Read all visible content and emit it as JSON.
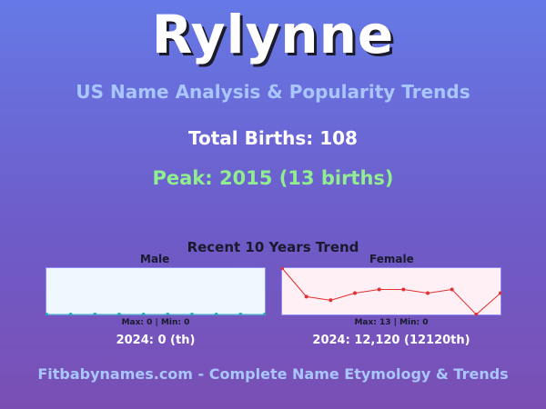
{
  "title": "Rylynne",
  "subtitle": "US Name Analysis & Popularity Trends",
  "total_births": "Total Births: 108",
  "peak": "Peak: 2015 (13 births)",
  "footer": "Fitbabynames.com - Complete Name Etymology & Trends",
  "colors": {
    "male_line": "#2aa7b8",
    "male_bg": "#f0f8ff",
    "female_line": "#e03030",
    "female_bg": "#fff0f5",
    "panel_border": "#8c8cff"
  },
  "chart_data": [
    {
      "type": "line",
      "title": "Recent 10 Years Trend",
      "panel_label": "Male",
      "series": [
        {
          "values": [
            0,
            0,
            0,
            0,
            0,
            0,
            0,
            0,
            0,
            0
          ]
        }
      ],
      "ylim": [
        0,
        13
      ],
      "maxmin": "Max: 0 | Min: 0",
      "rank_text": "2024: 0 (th)"
    },
    {
      "type": "line",
      "panel_label": "Female",
      "series": [
        {
          "values": [
            13,
            5,
            4,
            6,
            7,
            7,
            6,
            7,
            0,
            6
          ]
        }
      ],
      "ylim": [
        0,
        13
      ],
      "maxmin": "Max: 13 | Min: 0",
      "rank_text": "2024: 12,120 (12120th)"
    }
  ]
}
